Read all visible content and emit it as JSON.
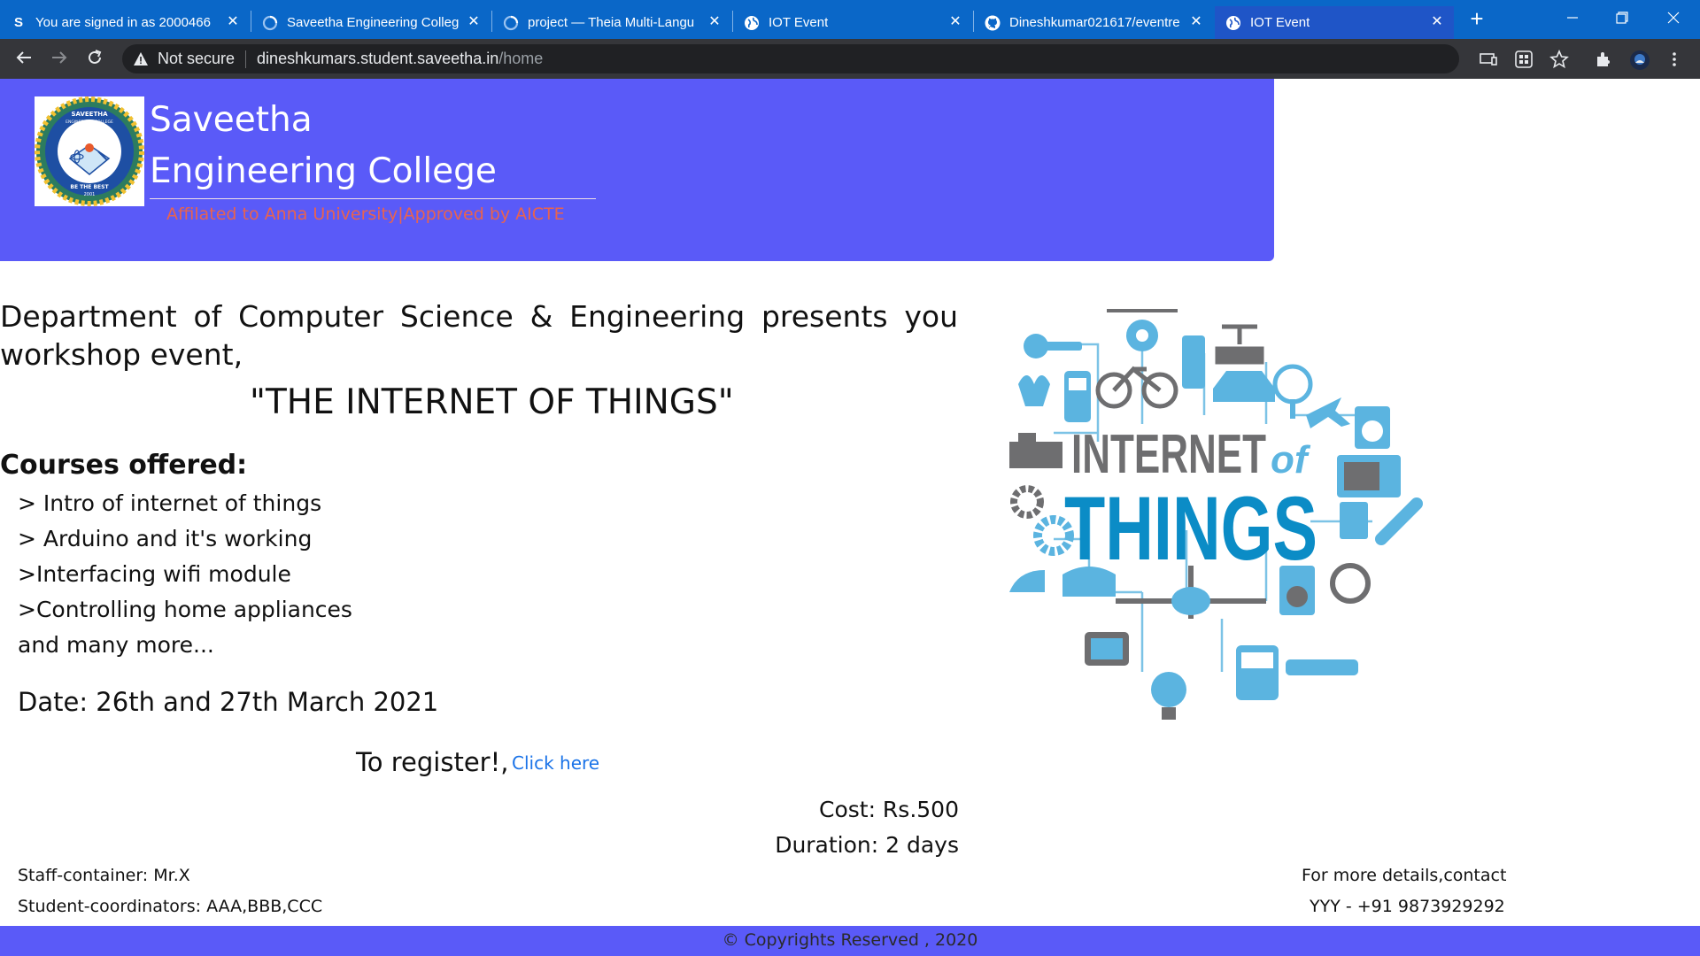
{
  "tabs": [
    {
      "title": "You are signed in as 2000466",
      "favicon": "s-letter-icon"
    },
    {
      "title": "Saveetha Engineering Colleg",
      "favicon": "loading-icon"
    },
    {
      "title": "project — Theia Multi-Langu",
      "favicon": "loading-icon"
    },
    {
      "title": "IOT Event",
      "favicon": "globe-icon"
    },
    {
      "title": "Dineshkumar021617/eventre",
      "favicon": "github-icon"
    },
    {
      "title": "IOT Event",
      "favicon": "globe-icon",
      "active": true
    }
  ],
  "omnibox": {
    "security": "Not secure",
    "host": "dineshkumars.student.saveetha.in",
    "path": "/home"
  },
  "header": {
    "college_line1": "Saveetha",
    "college_line2": "Engineering College",
    "tagline": "Affilated to Anna University|Approved by AICTE",
    "logo_top_text": "SAVEETHA",
    "logo_sub_text": "ENGINEERING COLLEGE",
    "logo_motto": "BE THE BEST",
    "logo_year": "2001",
    "bg_color": "#5a5af8",
    "tagline_color": "#e8634f"
  },
  "main": {
    "intro": "Department of Computer Science & Engineering presents you workshop event,",
    "event_title": "\"THE INTERNET OF THINGS\"",
    "courses_heading": "Courses offered:",
    "courses": [
      "> Intro of internet of things",
      "> Arduino and it's working",
      ">Interfacing wifi module",
      ">Controlling home appliances",
      "and many more..."
    ],
    "date": "Date: 26th and 27th March 2021",
    "register_text": "To register!,",
    "register_link": "Click here",
    "cost": "Cost: Rs.500",
    "duration": "Duration: 2 days",
    "staff": "Staff-container: Mr.X",
    "students": "Student-coordinators: AAA,BBB,CCC",
    "more_details": "For more details,contact",
    "contact": "YYY - +91 9873929292"
  },
  "iot_image": {
    "line1": "INTERNET",
    "of": "of",
    "line2": "THINGS"
  },
  "footer": {
    "text": "© Copyrights Reserved , 2020"
  }
}
